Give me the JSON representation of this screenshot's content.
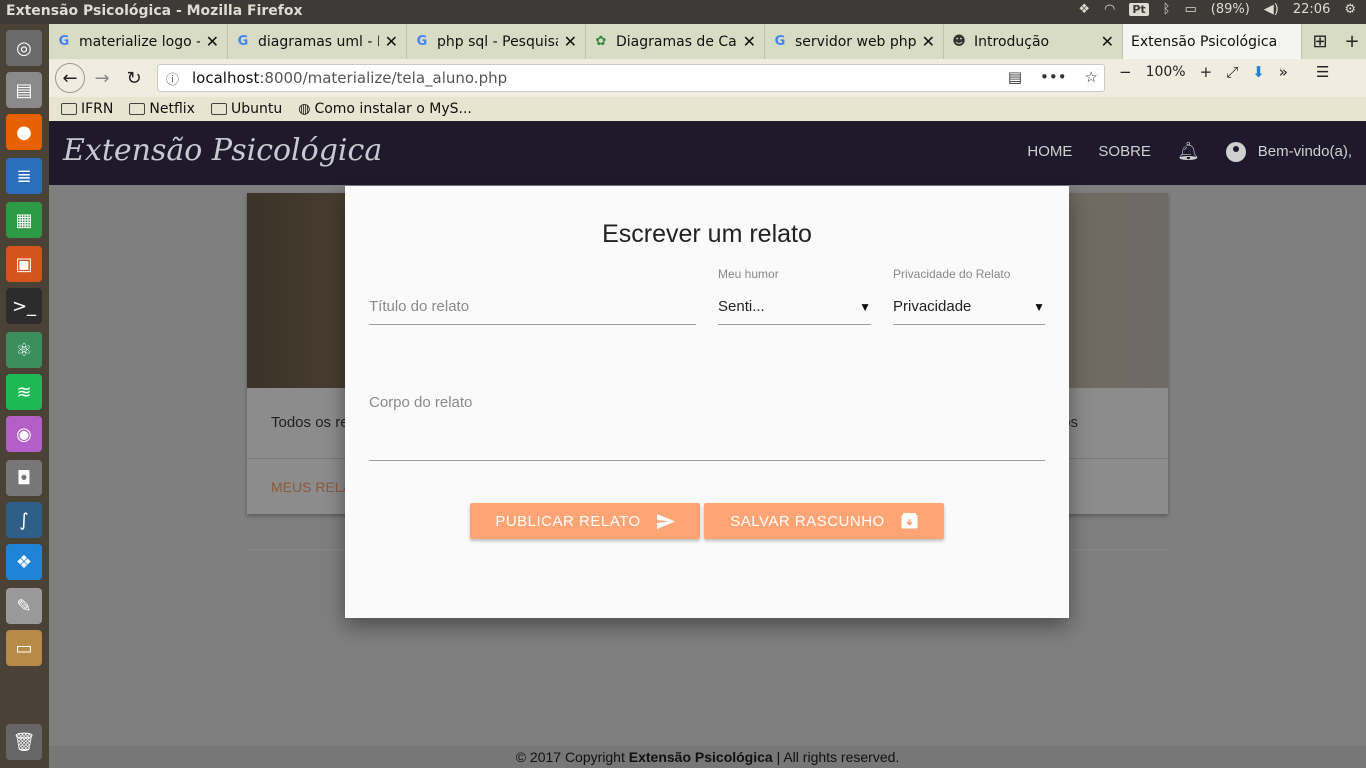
{
  "system": {
    "window_title": "Extensão Psicológica - Mozilla Firefox",
    "battery": "(89%)",
    "clock": "22:06",
    "keyboard_layout": "Pt"
  },
  "browser": {
    "tabs": [
      {
        "label": "materialize logo -",
        "icon": "google-icon"
      },
      {
        "label": "diagramas uml - P",
        "icon": "google-icon"
      },
      {
        "label": "php sql - Pesquisa",
        "icon": "google-icon"
      },
      {
        "label": "Diagramas de Cas",
        "icon": "site-icon"
      },
      {
        "label": "servidor web php",
        "icon": "google-icon"
      },
      {
        "label": "Introdução",
        "icon": "site-icon"
      },
      {
        "label": "Extensão Psicológica",
        "icon": "none"
      }
    ],
    "url_host": "localhost",
    "url_path": ":8000/materialize/tela_aluno.php",
    "zoom": "100%",
    "bookmarks": [
      "IFRN",
      "Netflix",
      "Ubuntu",
      "Como instalar o MyS..."
    ]
  },
  "site": {
    "brand": "Extensão Psicológica",
    "nav": {
      "home": "HOME",
      "about": "SOBRE",
      "welcome": "Bem-vindo(a),"
    },
    "card": {
      "text_left": "Todos os re",
      "text_right": "os",
      "link": "MEUS RELA"
    },
    "footer": {
      "prefix": "© 2017 Copyright ",
      "brand": "Extensão Psicológica",
      "suffix": " | All rights reserved."
    }
  },
  "modal": {
    "title": "Escrever um relato",
    "title_field": {
      "placeholder": "Título do relato",
      "value": ""
    },
    "mood": {
      "label": "Meu humor",
      "selected": "Senti..."
    },
    "privacy": {
      "label": "Privacidade do Relato",
      "selected": "Privacidade"
    },
    "body_field": {
      "placeholder": "Corpo do relato"
    },
    "publish_button": "PUBLICAR RELATO",
    "draft_button": "SALVAR RASCUNHO"
  },
  "colors": {
    "accent": "#ffa475",
    "navbar": "#1e1a2c",
    "modal_bg": "#fafafa"
  }
}
